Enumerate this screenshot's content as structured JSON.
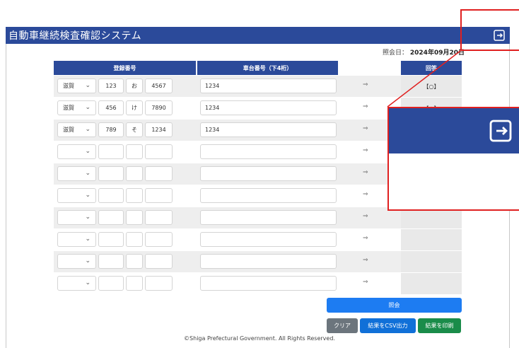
{
  "header": {
    "title": "自動車継続検査確認システム",
    "logout_icon": "logout-icon"
  },
  "inquiry_date": {
    "label": "照会日：",
    "value": "2024年09月20日"
  },
  "table": {
    "headers": {
      "registration": "登録番号",
      "car_number": "車台番号（下4桁）",
      "answer": "回答"
    },
    "rows": [
      {
        "pref": "滋賀",
        "num1": "123",
        "kana": "お",
        "num2": "4567",
        "car": "1234",
        "arrow": "⇒",
        "answer": "【○】"
      },
      {
        "pref": "滋賀",
        "num1": "456",
        "kana": "け",
        "num2": "7890",
        "car": "1234",
        "arrow": "⇒",
        "answer": "【○】"
      },
      {
        "pref": "滋賀",
        "num1": "789",
        "kana": "そ",
        "num2": "1234",
        "car": "1234",
        "arrow": "⇒",
        "answer": ""
      },
      {
        "pref": "",
        "num1": "",
        "kana": "",
        "num2": "",
        "car": "",
        "arrow": "⇒",
        "answer": ""
      },
      {
        "pref": "",
        "num1": "",
        "kana": "",
        "num2": "",
        "car": "",
        "arrow": "⇒",
        "answer": ""
      },
      {
        "pref": "",
        "num1": "",
        "kana": "",
        "num2": "",
        "car": "",
        "arrow": "⇒",
        "answer": ""
      },
      {
        "pref": "",
        "num1": "",
        "kana": "",
        "num2": "",
        "car": "",
        "arrow": "⇒",
        "answer": ""
      },
      {
        "pref": "",
        "num1": "",
        "kana": "",
        "num2": "",
        "car": "",
        "arrow": "⇒",
        "answer": ""
      },
      {
        "pref": "",
        "num1": "",
        "kana": "",
        "num2": "",
        "car": "",
        "arrow": "⇒",
        "answer": ""
      },
      {
        "pref": "",
        "num1": "",
        "kana": "",
        "num2": "",
        "car": "",
        "arrow": "⇒",
        "answer": ""
      }
    ]
  },
  "buttons": {
    "inquiry": "照会",
    "clear": "クリア",
    "csv": "結果をCSV出力",
    "print": "結果を印刷"
  },
  "footer": "©Shiga Prefectural Government. All Rights Reserved.",
  "colors": {
    "brand": "#2b4a9a",
    "primary": "#1d7cf2",
    "success": "#1a8c4a",
    "secondary": "#6c757d",
    "callout": "#e02020"
  }
}
